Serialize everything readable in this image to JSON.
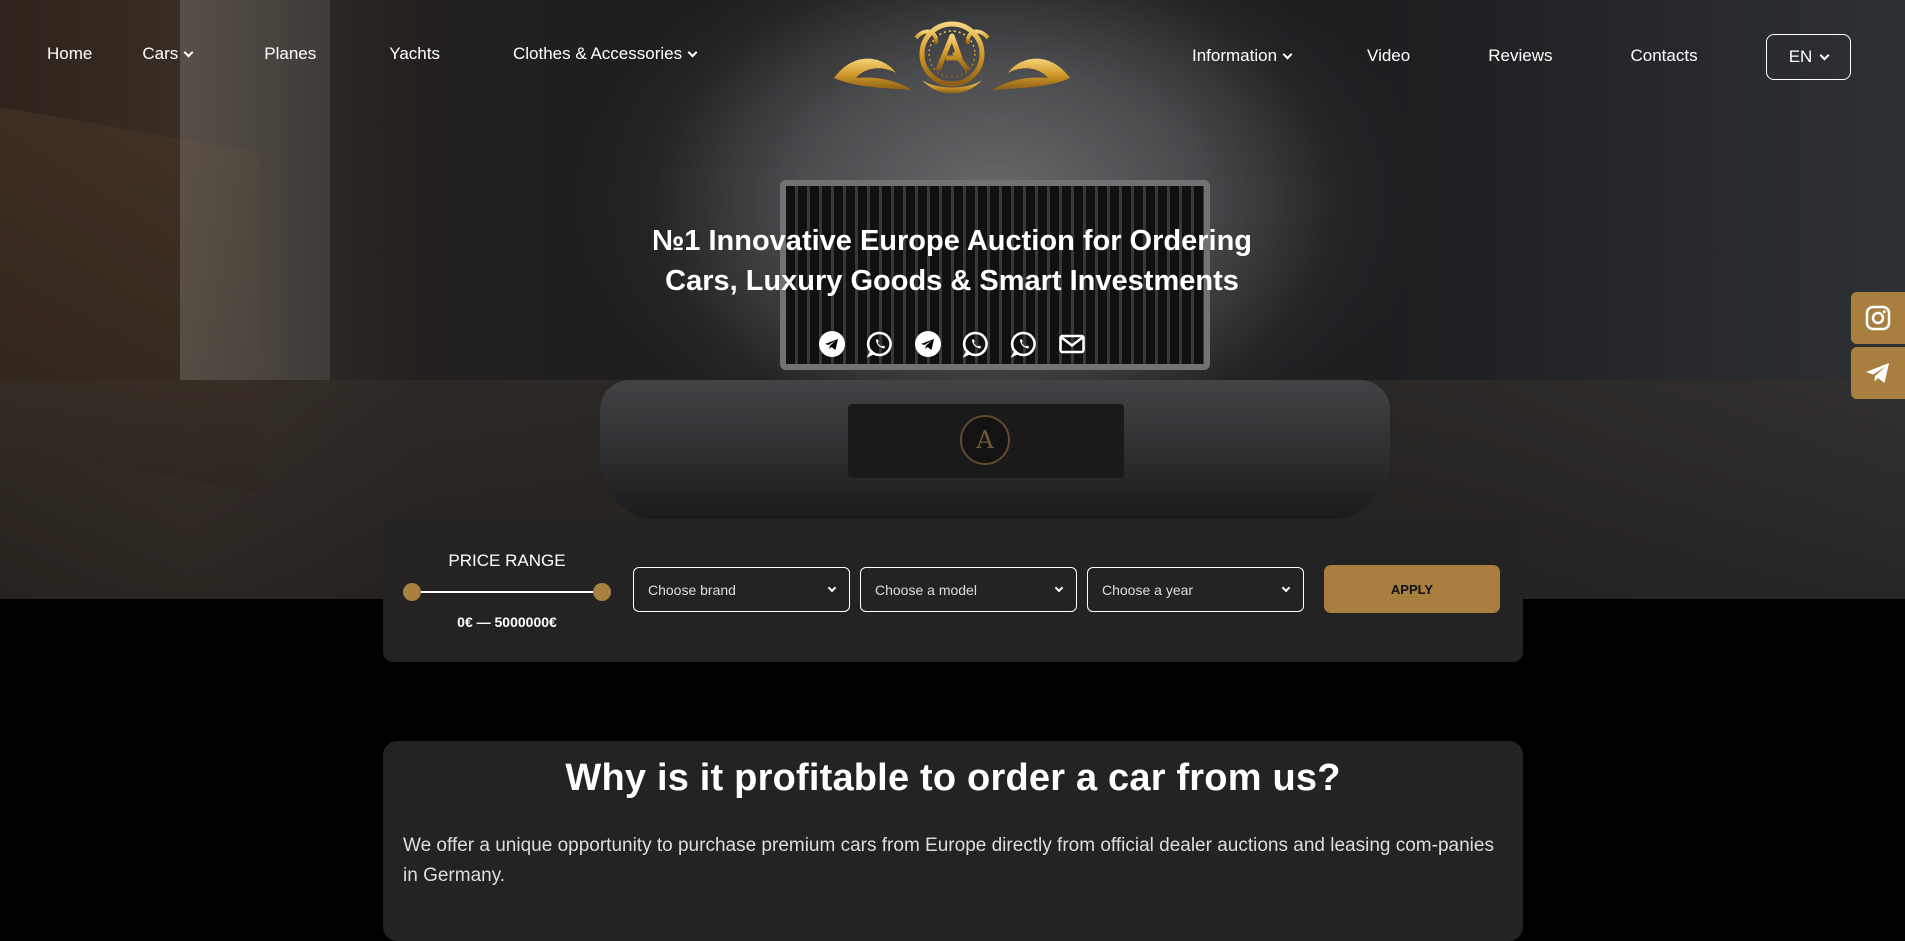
{
  "nav": {
    "left": [
      {
        "label": "Home"
      },
      {
        "label": "Cars"
      },
      {
        "label": "Planes"
      },
      {
        "label": "Yachts"
      },
      {
        "label": "Clothes & Accessories"
      }
    ],
    "right": [
      {
        "label": "Information"
      },
      {
        "label": "Video"
      },
      {
        "label": "Reviews"
      },
      {
        "label": "Contacts"
      }
    ],
    "language": "EN"
  },
  "hero": {
    "title_line1": "№1 Innovative Europe Auction for Ordering",
    "title_line2": "Cars, Luxury Goods & Smart Investments",
    "social_icons": [
      "telegram-icon",
      "whatsapp-icon",
      "telegram-icon",
      "whatsapp-icon",
      "whatsapp-icon",
      "mail-icon"
    ],
    "emblem_letter": "A"
  },
  "floating": [
    "instagram-icon",
    "telegram-icon"
  ],
  "filter": {
    "price_label": "PRICE RANGE",
    "price_value": "0€ — 5000000€",
    "price_min_fraction": 0,
    "price_max_fraction": 1,
    "brand_placeholder": "Choose brand",
    "model_placeholder": "Choose a model",
    "year_placeholder": "Choose a year",
    "apply_label": "APPLY"
  },
  "why": {
    "heading": "Why is it profitable to order a car from us?",
    "text": "We offer a unique opportunity to purchase premium cars from Europe directly from official dealer auctions and leasing com-panies in Germany."
  },
  "colors": {
    "accent_gold": "#a87f3e",
    "panel_bg": "#232323",
    "page_bg": "#000000"
  }
}
